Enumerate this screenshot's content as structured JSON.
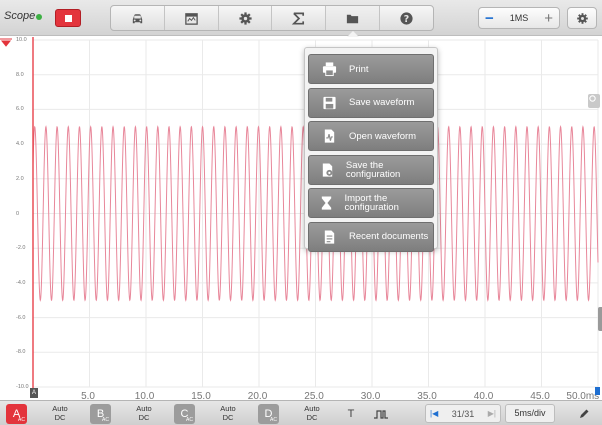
{
  "toolbar": {
    "app_name": "Scope",
    "stop_icon": "stop-icon",
    "tools": [
      {
        "icon": "car-icon"
      },
      {
        "icon": "calendar-icon"
      },
      {
        "icon": "gear-icon"
      },
      {
        "icon": "sigma-icon"
      },
      {
        "icon": "folder-icon"
      },
      {
        "icon": "help-icon"
      }
    ],
    "timebase": {
      "label": "1MS",
      "minus_icon": "minus-icon",
      "plus_icon": "plus-icon"
    },
    "settings_icon": "gear-icon"
  },
  "plot": {
    "y_tick_labels": [
      "10.0",
      "8.0",
      "6.0",
      "4.0",
      "2.0",
      "0",
      "-2.0",
      "-4.0",
      "-6.0",
      "-8.0",
      "-10.0"
    ],
    "x_tick_labels": [
      "5.0",
      "10.0",
      "15.0",
      "20.0",
      "25.0",
      "30.0",
      "35.0",
      "40.0",
      "45.0",
      "50.0ms"
    ],
    "x_origin_label": "A",
    "waveform": {
      "amplitude": 5.0,
      "cycles": 50.5,
      "color": "#e8879a"
    },
    "trigger_color": "#e8414b"
  },
  "file_menu": {
    "items": [
      {
        "label": "Print",
        "icon": "printer-icon"
      },
      {
        "label": "Save waveform",
        "icon": "save-icon"
      },
      {
        "label": "Open waveform",
        "icon": "open-waveform-icon"
      },
      {
        "label": "Save the configuration",
        "icon": "save-config-icon"
      },
      {
        "label": "Import the configuration",
        "icon": "import-config-icon"
      },
      {
        "label": "Recent documents",
        "icon": "recent-documents-icon"
      }
    ]
  },
  "bottom": {
    "channels": [
      {
        "letter": "A",
        "sub": "AC",
        "mode": "Auto DC",
        "color": "#e3343c"
      },
      {
        "letter": "B",
        "sub": "AC",
        "mode": "Auto DC",
        "color": "#9c9c9c"
      },
      {
        "letter": "C",
        "sub": "AC",
        "mode": "Auto DC",
        "color": "#9c9c9c"
      },
      {
        "letter": "D",
        "sub": "AC",
        "mode": "Auto DC",
        "color": "#9c9c9c"
      }
    ],
    "mode_line1": "Auto",
    "mode_line2": "DC",
    "text_tool": "T",
    "pulse_icon": "pulse-icon",
    "pages": "31/31",
    "first_page_icon": "first-page-icon",
    "last_page_icon": "last-page-icon",
    "time_div": "5ms/div",
    "measure_icon": "pen-icon"
  }
}
